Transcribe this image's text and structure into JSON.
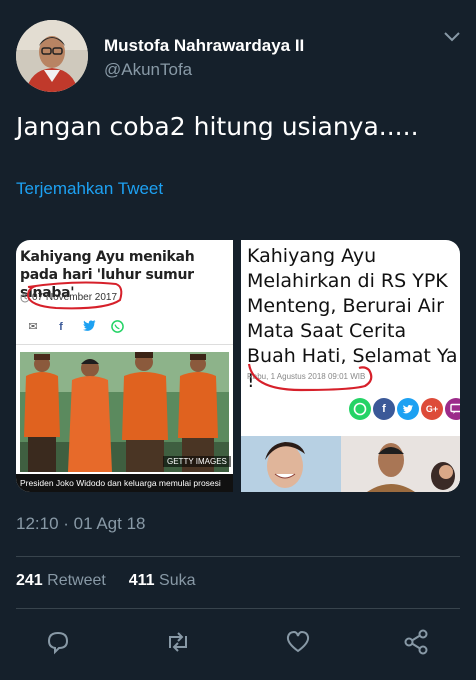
{
  "user": {
    "name": "Mustofa Nahrawardaya II",
    "handle": "@AkunTofa"
  },
  "tweet": {
    "text": "Jangan coba2 hitung usianya.....",
    "translate_label": "Terjemahkan Tweet",
    "timestamp": "12:10 · 01 Agt 18"
  },
  "media": {
    "left": {
      "title": "Kahiyang Ayu menikah pada hari 'luhur sumur sinaba'",
      "date": "07 November 2017",
      "watermark": "GETTY IMAGES",
      "caption": "Presiden Joko Widodo dan keluarga memulai prosesi"
    },
    "right": {
      "title": "Kahiyang Ayu Melahirkan di RS YPK Menteng, Berurai Air Mata Saat Cerita Buah Hati, Selamat Ya !",
      "date": "Rabu, 1 Agustus 2018 09:01 WIB"
    }
  },
  "stats": {
    "retweet_count": "241",
    "retweet_label": "Retweet",
    "like_count": "411",
    "like_label": "Suka"
  },
  "icons": {
    "reply": "reply-icon",
    "retweet": "retweet-icon",
    "like": "heart-icon",
    "share": "share-icon",
    "menu": "chevron-down-icon"
  },
  "colors": {
    "background": "#15202b",
    "accent": "#1da1f2",
    "secondary_text": "#8899a6",
    "divider": "#38444d",
    "annotation": "#d6202a"
  }
}
